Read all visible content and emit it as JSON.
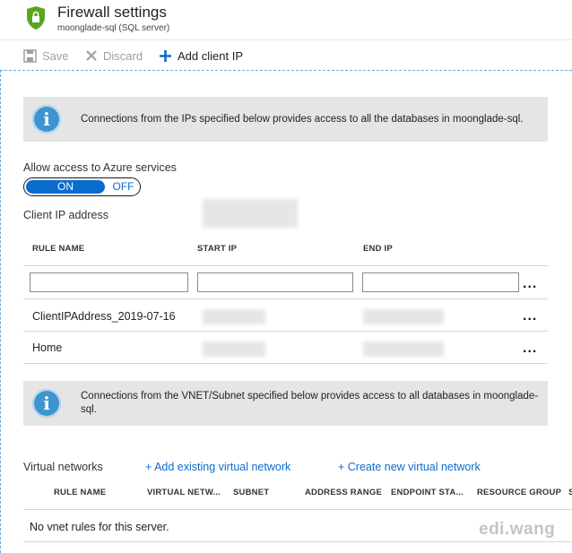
{
  "header": {
    "title": "Firewall settings",
    "subtitle": "moonglade-sql (SQL server)"
  },
  "toolbar": {
    "save_label": "Save",
    "discard_label": "Discard",
    "add_client_ip_label": "Add client IP"
  },
  "info1": {
    "text": "Connections from the IPs specified below provides access to all the databases in moonglade-sql."
  },
  "azure_access": {
    "label": "Allow access to Azure services",
    "on_label": "ON",
    "off_label": "OFF",
    "selected": "ON"
  },
  "client_ip": {
    "label": "Client IP address"
  },
  "rules_table": {
    "headers": [
      "RULE NAME",
      "START IP",
      "END IP"
    ],
    "rows": [
      {
        "name": "ClientIPAddress_2019-07-16"
      },
      {
        "name": "Home"
      }
    ],
    "more": "..."
  },
  "info2": {
    "text": "Connections from the VNET/Subnet specified below provides access to all databases in moonglade-sql."
  },
  "vnet": {
    "label": "Virtual networks",
    "add_existing": "+ Add existing virtual network",
    "create_new": "+ Create new virtual network",
    "headers": [
      "RULE NAME",
      "VIRTUAL NETW...",
      "SUBNET",
      "ADDRESS RANGE",
      "ENDPOINT STA...",
      "RESOURCE GROUP",
      "S"
    ],
    "empty_text": "No vnet rules for this server."
  },
  "watermark": "edi.wang",
  "colors": {
    "accent": "#0b6ccf",
    "shield": "#5aa71f",
    "info_icon": "#3d94d1",
    "info_bg": "#e5e5e5"
  }
}
